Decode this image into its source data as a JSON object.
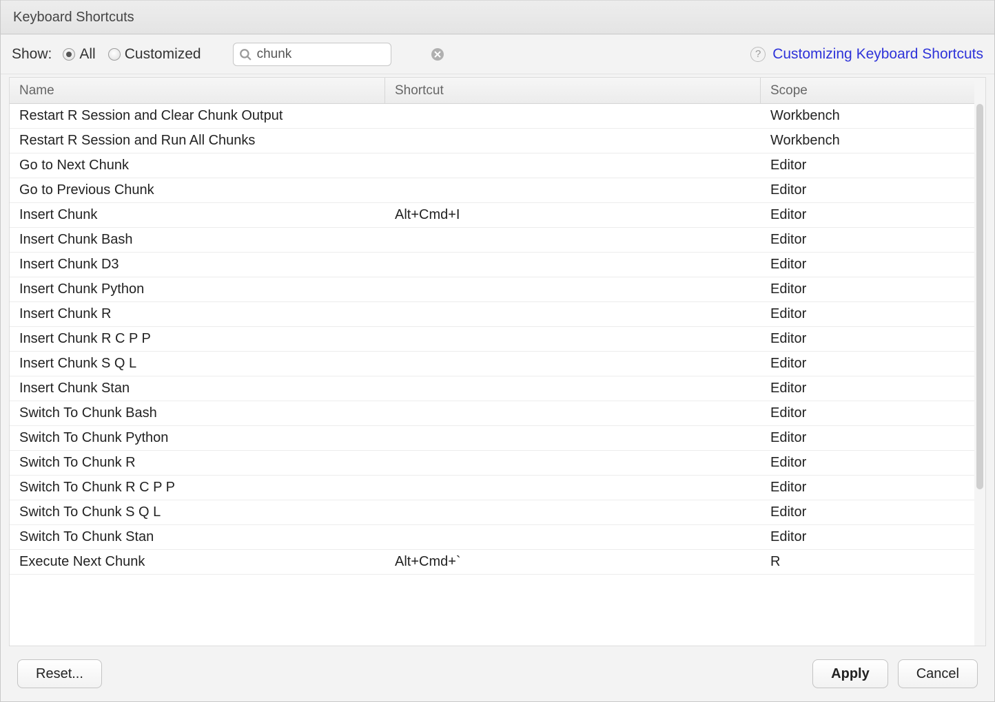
{
  "dialog": {
    "title": "Keyboard Shortcuts"
  },
  "toolbar": {
    "show_label": "Show:",
    "radio_all": "All",
    "radio_customized": "Customized",
    "selected": "all",
    "search_value": "chunk"
  },
  "help": {
    "link_text": "Customizing Keyboard Shortcuts"
  },
  "table": {
    "columns": {
      "name": "Name",
      "shortcut": "Shortcut",
      "scope": "Scope"
    },
    "rows": [
      {
        "name": "Restart R Session and Clear Chunk Output",
        "shortcut": "",
        "scope": "Workbench"
      },
      {
        "name": "Restart R Session and Run All Chunks",
        "shortcut": "",
        "scope": "Workbench"
      },
      {
        "name": "Go to Next Chunk",
        "shortcut": "",
        "scope": "Editor"
      },
      {
        "name": "Go to Previous Chunk",
        "shortcut": "",
        "scope": "Editor"
      },
      {
        "name": "Insert Chunk",
        "shortcut": "Alt+Cmd+I",
        "scope": "Editor"
      },
      {
        "name": "Insert Chunk Bash",
        "shortcut": "",
        "scope": "Editor"
      },
      {
        "name": "Insert Chunk D3",
        "shortcut": "",
        "scope": "Editor"
      },
      {
        "name": "Insert Chunk Python",
        "shortcut": "",
        "scope": "Editor"
      },
      {
        "name": "Insert Chunk R",
        "shortcut": "",
        "scope": "Editor"
      },
      {
        "name": "Insert Chunk R C P P",
        "shortcut": "",
        "scope": "Editor"
      },
      {
        "name": "Insert Chunk S Q L",
        "shortcut": "",
        "scope": "Editor"
      },
      {
        "name": "Insert Chunk Stan",
        "shortcut": "",
        "scope": "Editor"
      },
      {
        "name": "Switch To Chunk Bash",
        "shortcut": "",
        "scope": "Editor"
      },
      {
        "name": "Switch To Chunk Python",
        "shortcut": "",
        "scope": "Editor"
      },
      {
        "name": "Switch To Chunk R",
        "shortcut": "",
        "scope": "Editor"
      },
      {
        "name": "Switch To Chunk R C P P",
        "shortcut": "",
        "scope": "Editor"
      },
      {
        "name": "Switch To Chunk S Q L",
        "shortcut": "",
        "scope": "Editor"
      },
      {
        "name": "Switch To Chunk Stan",
        "shortcut": "",
        "scope": "Editor"
      },
      {
        "name": "Execute Next Chunk",
        "shortcut": "Alt+Cmd+`",
        "scope": "R"
      }
    ]
  },
  "footer": {
    "reset": "Reset...",
    "apply": "Apply",
    "cancel": "Cancel"
  }
}
